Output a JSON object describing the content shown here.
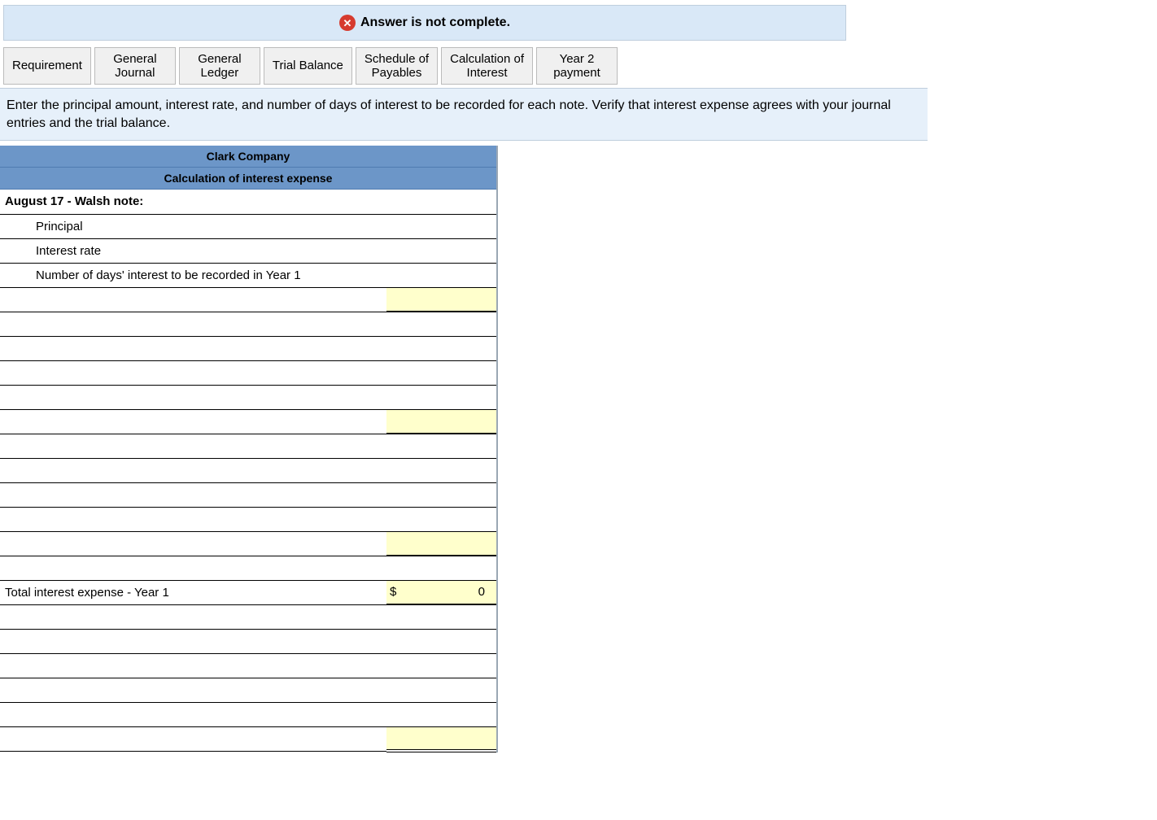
{
  "status": {
    "icon": "x-circle-icon",
    "text": "Answer is not complete."
  },
  "tabs": [
    "Requirement",
    "General\nJournal",
    "General\nLedger",
    "Trial Balance",
    "Schedule of\nPayables",
    "Calculation of\nInterest",
    "Year 2\npayment"
  ],
  "instruction": "Enter the principal amount, interest rate, and number of days of interest to be recorded for each note.  Verify that interest expense agrees with your journal entries and the trial balance.",
  "sheet": {
    "company": "Clark Company",
    "title": "Calculation of interest expense",
    "rows": [
      {
        "label": "August 17 - Walsh note:",
        "bold": true,
        "value": "",
        "col2class": ""
      },
      {
        "label": "Principal",
        "indent": true,
        "value": "",
        "col2class": ""
      },
      {
        "label": "Interest rate",
        "indent": true,
        "value": "",
        "col2class": ""
      },
      {
        "label": "Number of days' interest to be recorded in Year 1",
        "indent": true,
        "value": "",
        "col2class": ""
      },
      {
        "label": "",
        "value": "",
        "col2class": "hl"
      },
      {
        "label": "",
        "value": "",
        "col2class": ""
      },
      {
        "label": "",
        "value": "",
        "col2class": ""
      },
      {
        "label": "",
        "value": "",
        "col2class": ""
      },
      {
        "label": "",
        "value": "",
        "col2class": ""
      },
      {
        "label": "",
        "value": "",
        "col2class": "hl"
      },
      {
        "label": "",
        "value": "",
        "col2class": ""
      },
      {
        "label": "",
        "value": "",
        "col2class": ""
      },
      {
        "label": "",
        "value": "",
        "col2class": ""
      },
      {
        "label": "",
        "value": "",
        "col2class": ""
      },
      {
        "label": "",
        "value": "",
        "col2class": "hl"
      },
      {
        "label": "",
        "value": "",
        "col2class": ""
      },
      {
        "label": "Total interest expense - Year 1",
        "value": "0",
        "currency": "$",
        "col2class": "hl"
      },
      {
        "label": "",
        "value": "",
        "col2class": ""
      },
      {
        "label": "",
        "value": "",
        "col2class": ""
      },
      {
        "label": "",
        "value": "",
        "col2class": ""
      },
      {
        "label": "",
        "value": "",
        "col2class": ""
      },
      {
        "label": "",
        "value": "",
        "col2class": ""
      },
      {
        "label": "",
        "value": "",
        "col2class": "hl dbl"
      }
    ]
  }
}
